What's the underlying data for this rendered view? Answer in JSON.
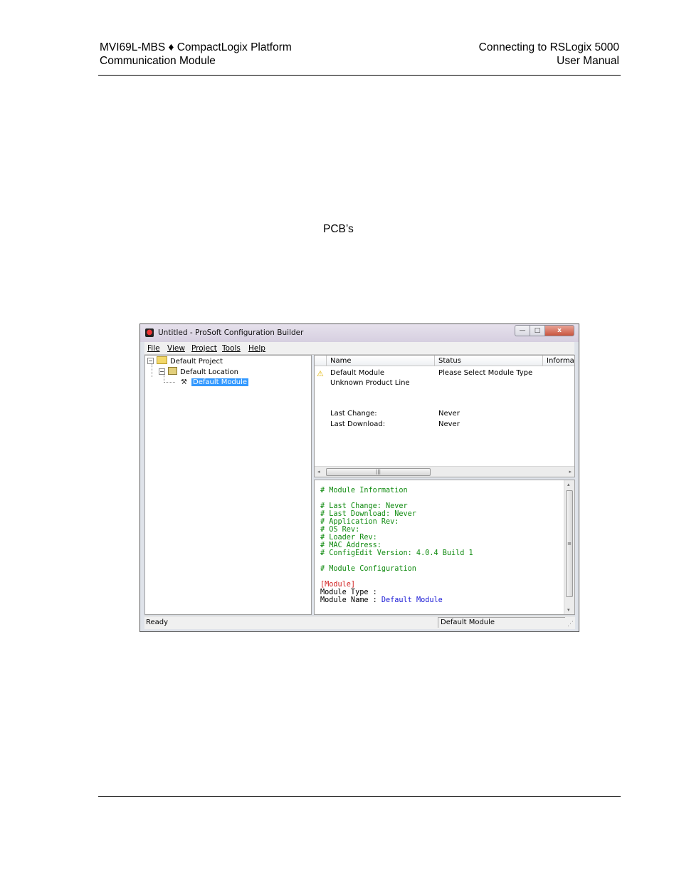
{
  "header": {
    "left_line1": "MVI69L-MBS ♦ CompactLogix Platform",
    "left_line2": "Communication Module",
    "right_line1": "Connecting to RSLogix 5000",
    "right_line2": "User Manual"
  },
  "body_text": "PCB’s",
  "window": {
    "title": "Untitled - ProSoft Configuration Builder",
    "buttons": {
      "minimize": "—",
      "maximize": "□",
      "close": "x"
    },
    "menu": [
      "File",
      "View",
      "Project",
      "Tools",
      "Help"
    ],
    "tree": {
      "project": "Default Project",
      "location": "Default Location",
      "module": "Default Module"
    },
    "list": {
      "columns": [
        "Name",
        "Status",
        "Informat"
      ],
      "rows": [
        {
          "name": "Default Module",
          "status": "Please Select Module Type"
        },
        {
          "name": "Unknown Product Line",
          "status": ""
        },
        {
          "name": "Last Change:",
          "status": "Never"
        },
        {
          "name": "Last Download:",
          "status": "Never"
        }
      ]
    },
    "config_text": {
      "line1": "# Module Information",
      "line2": "# Last Change: Never",
      "line3": "# Last Download: Never",
      "line4": "# Application Rev:",
      "line5": "# OS Rev:",
      "line6": "# Loader Rev:",
      "line7": "# MAC Address:",
      "line8": "# ConfigEdit Version: 4.0.4 Build 1",
      "line9": "# Module Configuration",
      "section": "[Module]",
      "type_label": "Module Type :",
      "name_label": "Module Name : ",
      "name_value": "Default Module"
    },
    "status": {
      "left": "Ready",
      "right": "Default Module"
    }
  },
  "colors": {
    "comment": "#108b10",
    "section": "#d12020",
    "value": "#1a1ad6",
    "selection": "#3399ff"
  }
}
